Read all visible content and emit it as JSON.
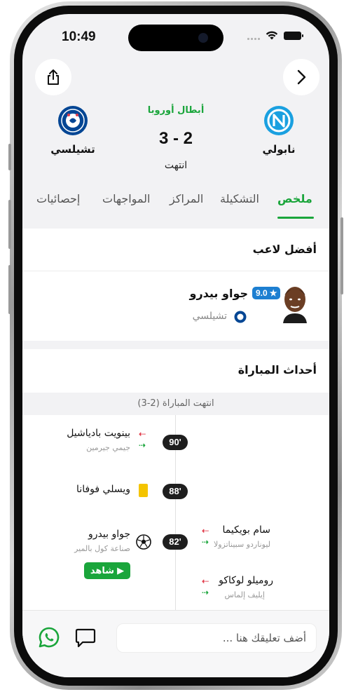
{
  "status_bar": {
    "time": "10:49"
  },
  "match": {
    "competition": "أبطال أوروبا",
    "score": "3 - 2",
    "status": "انتهت",
    "home_team": "نابولي",
    "away_team": "تشيلسي"
  },
  "tabs": [
    {
      "label": "ملخص",
      "active": true
    },
    {
      "label": "التشكيلة",
      "active": false
    },
    {
      "label": "المراكز",
      "active": false
    },
    {
      "label": "المواجهات",
      "active": false
    },
    {
      "label": "إحصائيات",
      "active": false
    }
  ],
  "best_player": {
    "section_title": "أفضل لاعب",
    "name": "جواو بيدرو",
    "rating": "9.0",
    "team": "تشيلسي"
  },
  "events": {
    "section_title": "أحداث المباراة",
    "ended_label": "انتهت المباراة (2-3)",
    "items": [
      {
        "minute": "90'",
        "type": "substitution",
        "side": "left",
        "player_in": "بينويت بادياشيل",
        "player_out": "جيمي جيرمين"
      },
      {
        "minute": "88'",
        "type": "yellow-card",
        "side": "left",
        "player": "ويسلي فوفانا"
      },
      {
        "minute": "82'",
        "type": "goal",
        "side": "left",
        "player": "جواو بيدرو",
        "assist": "صناعة  كول بالمير",
        "watch_label": "شاهد"
      },
      {
        "minute": "",
        "type": "substitution",
        "side": "right",
        "player_in": "سام بويكيما",
        "player_out": "ليوناردو سبيناتزولا"
      },
      {
        "minute": "",
        "type": "substitution",
        "side": "right",
        "player_in": "روميلو لوكاكو",
        "player_out": "إيليف إلماس"
      }
    ]
  },
  "comment": {
    "placeholder": "أضف تعليقك هنا ..."
  },
  "colors": {
    "accent_green": "#1aa53b",
    "rating_blue": "#1d7fd1",
    "yellow_card": "#f4c400",
    "napoli_blue": "#1aa0e0",
    "chelsea_blue": "#034694"
  }
}
